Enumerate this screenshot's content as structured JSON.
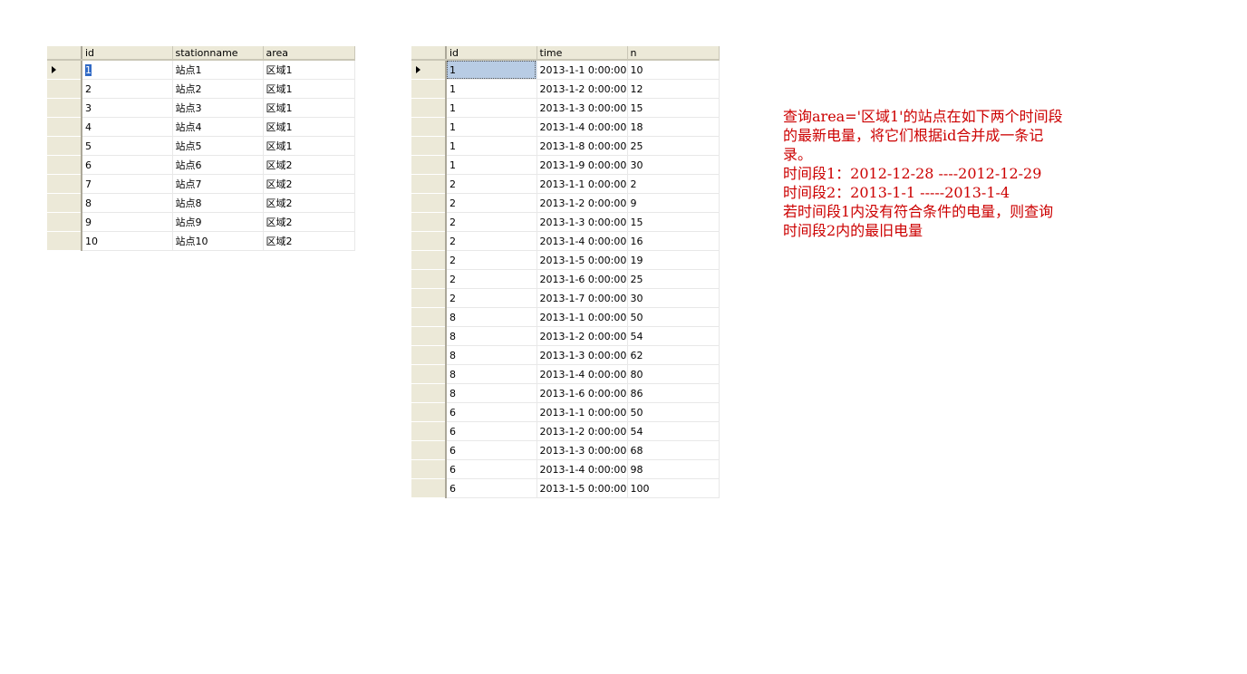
{
  "station_table": {
    "columns": [
      "id",
      "stationname",
      "area"
    ],
    "rows": [
      [
        "1",
        "站点1",
        "区域1"
      ],
      [
        "2",
        "站点2",
        "区域1"
      ],
      [
        "3",
        "站点3",
        "区域1"
      ],
      [
        "4",
        "站点4",
        "区域1"
      ],
      [
        "5",
        "站点5",
        "区域1"
      ],
      [
        "6",
        "站点6",
        "区域2"
      ],
      [
        "7",
        "站点7",
        "区域2"
      ],
      [
        "8",
        "站点8",
        "区域2"
      ],
      [
        "9",
        "站点9",
        "区域2"
      ],
      [
        "10",
        "站点10",
        "区域2"
      ]
    ]
  },
  "reading_table": {
    "columns": [
      "id",
      "time",
      "n"
    ],
    "rows": [
      [
        "1",
        "2013-1-1 0:00:00",
        "10"
      ],
      [
        "1",
        "2013-1-2 0:00:00",
        "12"
      ],
      [
        "1",
        "2013-1-3 0:00:00",
        "15"
      ],
      [
        "1",
        "2013-1-4 0:00:00",
        "18"
      ],
      [
        "1",
        "2013-1-8 0:00:00",
        "25"
      ],
      [
        "1",
        "2013-1-9 0:00:00",
        "30"
      ],
      [
        "2",
        "2013-1-1 0:00:00",
        "2"
      ],
      [
        "2",
        "2013-1-2 0:00:00",
        "9"
      ],
      [
        "2",
        "2013-1-3 0:00:00",
        "15"
      ],
      [
        "2",
        "2013-1-4 0:00:00",
        "16"
      ],
      [
        "2",
        "2013-1-5 0:00:00",
        "19"
      ],
      [
        "2",
        "2013-1-6 0:00:00",
        "25"
      ],
      [
        "2",
        "2013-1-7 0:00:00",
        "30"
      ],
      [
        "8",
        "2013-1-1 0:00:00",
        "50"
      ],
      [
        "8",
        "2013-1-2 0:00:00",
        "54"
      ],
      [
        "8",
        "2013-1-3 0:00:00",
        "62"
      ],
      [
        "8",
        "2013-1-4 0:00:00",
        "80"
      ],
      [
        "8",
        "2013-1-6 0:00:00",
        "86"
      ],
      [
        "6",
        "2013-1-1 0:00:00",
        "50"
      ],
      [
        "6",
        "2013-1-2 0:00:00",
        "54"
      ],
      [
        "6",
        "2013-1-3 0:00:00",
        "68"
      ],
      [
        "6",
        "2013-1-4 0:00:00",
        "98"
      ],
      [
        "6",
        "2013-1-5 0:00:00",
        "100"
      ]
    ]
  },
  "note": {
    "lines": [
      "查询area='区域1'的站点在如下两个时间段",
      "的最新电量，将它们根据id合并成一条记",
      "录。",
      "时间段1：2012-12-28 ----2012-12-29",
      "时间段2：2013-1-1 -----2013-1-4",
      "若时间段1内没有符合条件的电量，则查询",
      "时间段2内的最旧电量"
    ],
    "color": "#cc0000"
  },
  "colors": {
    "header_bg": "#ece9d8",
    "selection": "#316ac5"
  }
}
